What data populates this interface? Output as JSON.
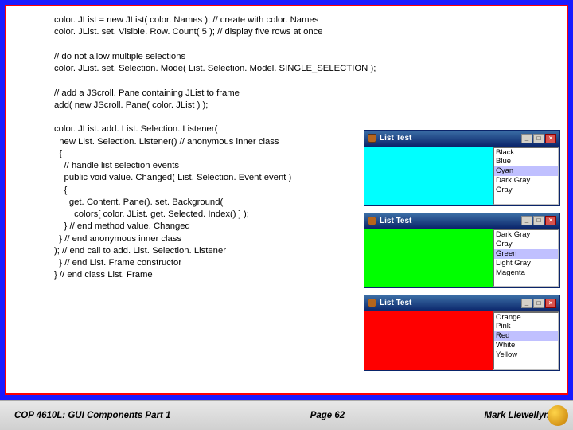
{
  "code": {
    "l1": "color. JList = new JList( color. Names ); // create with color. Names",
    "l2": "color. JList. set. Visible. Row. Count( 5 ); // display five rows at once",
    "l3": "",
    "l4": "// do not allow multiple selections",
    "l5": "color. JList. set. Selection. Mode( List. Selection. Model. SINGLE_SELECTION );",
    "l6": "",
    "l7": "// add a JScroll. Pane containing JList to frame",
    "l8": "add( new JScroll. Pane( color. JList ) );",
    "l9": "",
    "l10": "color. JList. add. List. Selection. Listener(",
    "l11": "  new List. Selection. Listener() // anonymous inner class",
    "l12": "  {  ",
    "l13": "    // handle list selection events",
    "l14": "    public void value. Changed( List. Selection. Event event )",
    "l15": "    {",
    "l16": "      get. Content. Pane(). set. Background( ",
    "l17": "        colors[ color. JList. get. Selected. Index() ] );",
    "l18": "    } // end method value. Changed",
    "l19": "  } // end anonymous inner class",
    "l20": "); // end call to add. List. Selection. Listener",
    "l21": "  } // end List. Frame constructor",
    "l22": "} // end class List. Frame"
  },
  "windows": [
    {
      "title": "List Test",
      "bg": "cyan",
      "items": [
        "Black",
        "Blue",
        "Cyan",
        "Dark Gray",
        "Gray"
      ],
      "selIdx": 2
    },
    {
      "title": "List Test",
      "bg": "green",
      "items": [
        "Dark Gray",
        "Gray",
        "Green",
        "Light Gray",
        "Magenta"
      ],
      "selIdx": 2
    },
    {
      "title": "List Test",
      "bg": "red",
      "items": [
        "Orange",
        "Pink",
        "Red",
        "White",
        "Yellow"
      ],
      "selIdx": 2
    }
  ],
  "winbtn": {
    "min": "_",
    "max": "□",
    "close": "×"
  },
  "footer": {
    "left": "COP 4610L: GUI Components Part 1",
    "center": "Page 62",
    "right": "Mark Llewellyn ©"
  }
}
